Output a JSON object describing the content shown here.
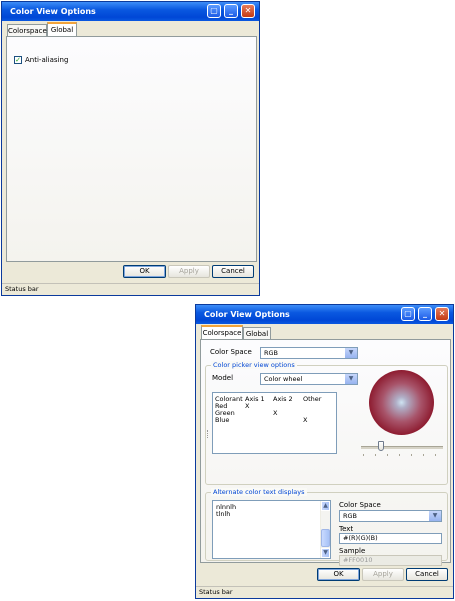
{
  "window1": {
    "title": "Color View Options",
    "tabs": [
      {
        "label": "Colorspace"
      },
      {
        "label": "Global"
      }
    ],
    "anti_aliasing_label": "Anti-aliasing",
    "anti_aliasing_checked": true,
    "buttons": {
      "ok": "OK",
      "apply": "Apply",
      "cancel": "Cancel"
    },
    "status": "Status bar"
  },
  "window2": {
    "title": "Color View Options",
    "tabs": [
      {
        "label": "Colorspace"
      },
      {
        "label": "Global"
      }
    ],
    "color_space_label": "Color Space",
    "color_space_value": "RGB",
    "picker_group_title": "Color picker view options",
    "model_label": "Model",
    "model_value": "Color wheel",
    "axes_table": {
      "headers": [
        "Colorant",
        "Axis 1",
        "Axis 2",
        "Other"
      ],
      "rows": [
        {
          "name": "Red",
          "axis1": "X",
          "axis2": "",
          "other": ""
        },
        {
          "name": "Green",
          "axis1": "",
          "axis2": "X",
          "other": ""
        },
        {
          "name": "Blue",
          "axis1": "",
          "axis2": "",
          "other": "X"
        }
      ]
    },
    "alt_group_title": "Alternate color text displays",
    "alt_list": [
      "nlnnlh",
      "tlnlh"
    ],
    "alt_color_space_label": "Color Space",
    "alt_color_space_value": "RGB",
    "text_label": "Text",
    "text_value": "#(R)(G)(B)",
    "sample_label": "Sample",
    "sample_value": "#FF0010",
    "buttons": {
      "ok": "OK",
      "apply": "Apply",
      "cancel": "Cancel"
    },
    "status": "Status bar"
  }
}
